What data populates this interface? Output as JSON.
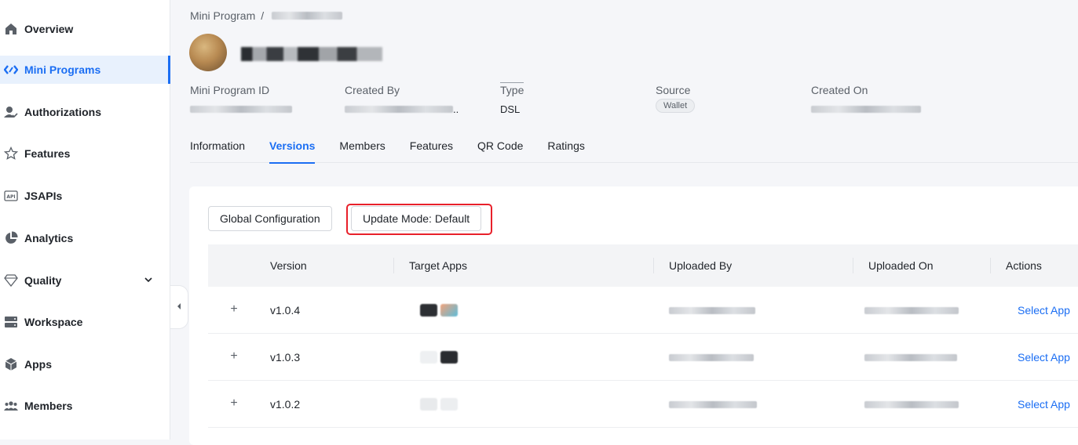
{
  "sidebar": {
    "items": [
      {
        "label": "Overview",
        "icon": "home-icon"
      },
      {
        "label": "Mini Programs",
        "icon": "code-icon",
        "active": true
      },
      {
        "label": "Authorizations",
        "icon": "user-check-icon"
      },
      {
        "label": "Features",
        "icon": "star-icon"
      },
      {
        "label": "JSAPIs",
        "icon": "api-icon"
      },
      {
        "label": "Analytics",
        "icon": "pie-chart-icon"
      },
      {
        "label": "Quality",
        "icon": "diamond-icon",
        "expandable": true
      },
      {
        "label": "Workspace",
        "icon": "server-icon"
      },
      {
        "label": "Apps",
        "icon": "cube-icon"
      },
      {
        "label": "Members",
        "icon": "team-icon"
      }
    ]
  },
  "header": {
    "breadcrumb_root": "Mini Program",
    "breadcrumb_sep": "/"
  },
  "meta": {
    "id_label": "Mini Program ID",
    "created_by_label": "Created By",
    "created_by_suffix": "..",
    "type_label": "Type",
    "type_value": "DSL",
    "source_label": "Source",
    "source_value": "Wallet",
    "created_on_label": "Created On"
  },
  "tabs": [
    {
      "label": "Information"
    },
    {
      "label": "Versions",
      "active": true
    },
    {
      "label": "Members"
    },
    {
      "label": "Features"
    },
    {
      "label": "QR Code"
    },
    {
      "label": "Ratings"
    }
  ],
  "buttons": {
    "global_config": "Global Configuration",
    "update_mode": "Update Mode: Default"
  },
  "table": {
    "columns": [
      "Version",
      "Target Apps",
      "Uploaded By",
      "Uploaded On",
      "Actions"
    ],
    "rows": [
      {
        "version": "v1.0.4",
        "action": "Select App"
      },
      {
        "version": "v1.0.3",
        "action": "Select App"
      },
      {
        "version": "v1.0.2",
        "action": "Select App"
      }
    ],
    "expand_symbol": "+"
  },
  "colors": {
    "accent": "#1b6ef3",
    "highlight": "#e8202a"
  }
}
